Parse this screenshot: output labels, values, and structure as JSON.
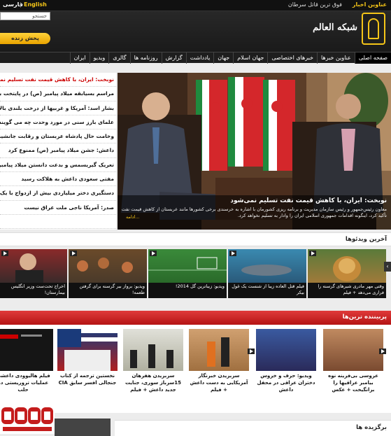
{
  "header": {
    "lang_en": "English",
    "lang_fa": "فارسی",
    "lang_sep": "|",
    "ticker_label": "عناوین اخبار",
    "ticker_text": "فوق ترین قاتل سرطان",
    "search_placeholder": "جستجو",
    "live_label": "پخش زنده",
    "logo_text": "شبکه العالم"
  },
  "nav": {
    "items": [
      "صفحه اصلی",
      "عناوین خبرها",
      "خبرهای اختصاصی",
      "جهان اسلام",
      "جهان",
      "یادداشت",
      "گزارش",
      "روزنامه ها",
      "گالری",
      "ویدیو",
      "ایران"
    ]
  },
  "headlines": [
    "نوبخت: ایران، با کاهش قیمت نفت تسلیم نمی‌شود",
    "مراسم بسیابقه میلاد پیامبر (ص) در پایتخت بنی عباس",
    "بشار اسد: آمریکا و غربیها از درخت بلندی بالا رفته‌اند",
    "علمای بارز سنی در مورد وحدت چه می گویند ؟",
    "وخامت حال پادشاه عربستان و رقابت جانشینی‌ها",
    "داعش: جشن میلاد پیامبر (ص) ممنوع کرد",
    "تعریک گیریسمس و بدعت دانستن میلاد پیامبر!",
    "مفتی سعودی داعش به هلاکت رسید",
    "دستگیری دختر میلیاردی بیش از ازدواج با یک داعشی",
    "صدر: آمریکا ناجی ملت عراق نیست"
  ],
  "hero": {
    "caption_title": "نوبخت: ایران، با کاهش قیمت نفت تسلیم نمی‌شود",
    "caption_text": "معاون رئیس‌جمهور و رئیس سازمان مدیریت و برنامه ریزی کشورمان با اشاره به خرسندی برخی کشورها مانند عربستان از کاهش قیمت نفت تأکید کرد، اینگونه اقدامات جمهوری اسلامی ایران را وادار به تسلیم نخواهد کرد.",
    "more_label": "ادامه..."
  },
  "latest_videos": {
    "title": "آخرین ویدئوها",
    "items": [
      "وقتی مهر مادری شیرهای گرسنه را فراری می‌دهد + فیلم",
      "فیلم قتل العاده زیبا از شنست یک غول بیکر",
      "ویدیو: زیباترین گل 2014!",
      "ویدیو: برواز بیر گرسنه برای گرفتن طعمه!",
      "اخراج تحت‌ست وزیر انگلیس بیمارستان!"
    ],
    "arrow": "‹"
  },
  "most_viewed": {
    "title": "پربیننده ترین‌ها",
    "items": [
      "عروسی بی‌فرینه نوه بیامبر عراقیها را برانگیخت + عکس",
      "ویدیو: حرف و خروس دختران عراقی در محفل داعش",
      "سربریدن خبرنگار آمریکایی به دست داعش + فیلم",
      "سربریدن هفرهان 15سرباز سوری، جنایت جدید داعش + فیلم",
      "نخستین ترجمه از کتاب جنجالی افسر سابق CIA",
      "فیلم هالیوودی داعشی عملیات تروریستی در حلب"
    ]
  },
  "picks": {
    "title": "برگزیده ها"
  }
}
